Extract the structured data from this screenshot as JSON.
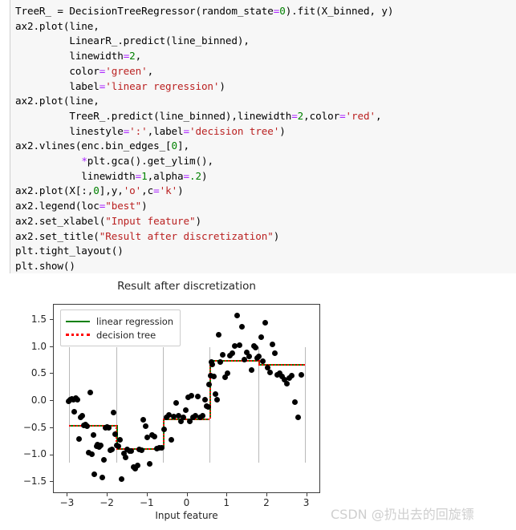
{
  "code_cell": {
    "language": "python",
    "lines": [
      [
        {
          "t": "TreeR_ = DecisionTreeRegressor(random_state",
          "c": "k"
        },
        {
          "t": "=",
          "c": "op"
        },
        {
          "t": "0",
          "c": "n"
        },
        {
          "t": ").fit(X_binned, y)",
          "c": "k"
        }
      ],
      [
        {
          "t": "ax2.plot(line,",
          "c": "k"
        }
      ],
      [
        {
          "t": "         LinearR_.predict(line_binned),",
          "c": "k"
        }
      ],
      [
        {
          "t": "         linewidth",
          "c": "k"
        },
        {
          "t": "=",
          "c": "op"
        },
        {
          "t": "2",
          "c": "n"
        },
        {
          "t": ",",
          "c": "k"
        }
      ],
      [
        {
          "t": "         color",
          "c": "k"
        },
        {
          "t": "=",
          "c": "op"
        },
        {
          "t": "'green'",
          "c": "s"
        },
        {
          "t": ",",
          "c": "k"
        }
      ],
      [
        {
          "t": "         label",
          "c": "k"
        },
        {
          "t": "=",
          "c": "op"
        },
        {
          "t": "'linear regression'",
          "c": "s"
        },
        {
          "t": ")",
          "c": "k"
        }
      ],
      [
        {
          "t": "ax2.plot(line,",
          "c": "k"
        }
      ],
      [
        {
          "t": "         TreeR_.predict(line_binned),linewidth",
          "c": "k"
        },
        {
          "t": "=",
          "c": "op"
        },
        {
          "t": "2",
          "c": "n"
        },
        {
          "t": ",color",
          "c": "k"
        },
        {
          "t": "=",
          "c": "op"
        },
        {
          "t": "'red'",
          "c": "s"
        },
        {
          "t": ",",
          "c": "k"
        }
      ],
      [
        {
          "t": "         linestyle",
          "c": "k"
        },
        {
          "t": "=",
          "c": "op"
        },
        {
          "t": "':'",
          "c": "s"
        },
        {
          "t": ",label",
          "c": "k"
        },
        {
          "t": "=",
          "c": "op"
        },
        {
          "t": "'decision tree'",
          "c": "s"
        },
        {
          "t": ")",
          "c": "k"
        }
      ],
      [
        {
          "t": "ax2.vlines(enc.bin_edges_[",
          "c": "k"
        },
        {
          "t": "0",
          "c": "n"
        },
        {
          "t": "],",
          "c": "k"
        }
      ],
      [
        {
          "t": "           ",
          "c": "k"
        },
        {
          "t": "*",
          "c": "op"
        },
        {
          "t": "plt.gca().get_ylim(),",
          "c": "k"
        }
      ],
      [
        {
          "t": "           linewidth",
          "c": "k"
        },
        {
          "t": "=",
          "c": "op"
        },
        {
          "t": "1",
          "c": "n"
        },
        {
          "t": ",alpha",
          "c": "k"
        },
        {
          "t": "=",
          "c": "op"
        },
        {
          "t": ".2",
          "c": "n"
        },
        {
          "t": ")",
          "c": "k"
        }
      ],
      [
        {
          "t": "ax2.plot(X[:,",
          "c": "k"
        },
        {
          "t": "0",
          "c": "n"
        },
        {
          "t": "],y,",
          "c": "k"
        },
        {
          "t": "'o'",
          "c": "s"
        },
        {
          "t": ",c",
          "c": "k"
        },
        {
          "t": "=",
          "c": "op"
        },
        {
          "t": "'k'",
          "c": "s"
        },
        {
          "t": ")",
          "c": "k"
        }
      ],
      [
        {
          "t": "ax2.legend(loc",
          "c": "k"
        },
        {
          "t": "=",
          "c": "op"
        },
        {
          "t": "\"best\"",
          "c": "s"
        },
        {
          "t": ")",
          "c": "k"
        }
      ],
      [
        {
          "t": "ax2.set_xlabel(",
          "c": "k"
        },
        {
          "t": "\"Input feature\"",
          "c": "s"
        },
        {
          "t": ")",
          "c": "k"
        }
      ],
      [
        {
          "t": "ax2.set_title(",
          "c": "k"
        },
        {
          "t": "\"Result after discretization\"",
          "c": "s"
        },
        {
          "t": ")",
          "c": "k"
        }
      ],
      [
        {
          "t": "plt.tight_layout()",
          "c": "k"
        }
      ],
      [
        {
          "t": "plt.show()",
          "c": "k"
        }
      ]
    ],
    "colors": {
      "background": "#f7f7f7",
      "text": "#000000",
      "string": "#BA2121",
      "number": "#008000",
      "operator": "#AA22FF"
    }
  },
  "watermark": {
    "text": "CSDN @扔出去的回旋镖",
    "color": "#cfcfcf"
  },
  "chart_data": {
    "type": "scatter",
    "title": "Result after discretization",
    "xlabel": "Input feature",
    "ylabel": "",
    "xlim": [
      -3.35,
      3.35
    ],
    "ylim": [
      -1.72,
      1.78
    ],
    "xticks": [
      "-3",
      "-2",
      "-1",
      "0",
      "1",
      "2",
      "3"
    ],
    "xtick_values": [
      -3,
      -2,
      -1,
      0,
      1,
      2,
      3
    ],
    "yticks": [
      "1.5",
      "1.0",
      "0.5",
      "0.0",
      "-0.5",
      "-1.0",
      "-1.5"
    ],
    "ytick_values": [
      1.5,
      1.0,
      0.5,
      0.0,
      -0.5,
      -1.0,
      -1.5
    ],
    "grid": false,
    "legend_position": "upper left",
    "legend": [
      {
        "label": "linear regression",
        "color": "#008000",
        "style": "solid"
      },
      {
        "label": "decision tree",
        "color": "#ff0000",
        "style": "dotted"
      }
    ],
    "bin_edges": [
      -2.96,
      -1.79,
      -0.62,
      0.55,
      1.78,
      2.95
    ],
    "bin_edge_color": "#b9b9b9",
    "step_series": {
      "name": "binned prediction (linear regression == decision tree)",
      "bin_starts": [
        -2.96,
        -1.79,
        -0.62,
        0.55,
        1.78
      ],
      "bin_ends": [
        -1.79,
        -0.62,
        0.55,
        1.78,
        2.95
      ],
      "values": [
        -0.44,
        -0.87,
        -0.33,
        0.76,
        0.68
      ]
    },
    "series": [
      {
        "name": "data",
        "marker": "o",
        "color": "#000000",
        "points": [
          [
            -2.98,
            0.0
          ],
          [
            -2.94,
            0.02
          ],
          [
            -2.9,
            0.04
          ],
          [
            -2.86,
            0.03
          ],
          [
            -2.83,
            -0.2
          ],
          [
            -2.79,
            0.05
          ],
          [
            -2.76,
            0.02
          ],
          [
            -2.71,
            -0.71
          ],
          [
            -2.68,
            -0.3
          ],
          [
            -2.64,
            -0.27
          ],
          [
            -2.6,
            -0.45
          ],
          [
            -2.56,
            -0.44
          ],
          [
            -2.52,
            -0.47
          ],
          [
            -2.47,
            -0.96
          ],
          [
            -2.43,
            0.15
          ],
          [
            -2.4,
            -0.98
          ],
          [
            -2.36,
            -0.63
          ],
          [
            -2.33,
            -1.36
          ],
          [
            -2.28,
            -0.83
          ],
          [
            -2.25,
            -0.8
          ],
          [
            -2.21,
            -0.85
          ],
          [
            -2.17,
            -0.82
          ],
          [
            -2.13,
            -1.41
          ],
          [
            -2.1,
            -1.09
          ],
          [
            -2.06,
            -0.5
          ],
          [
            -2.02,
            -0.48
          ],
          [
            -1.98,
            -0.49
          ],
          [
            -1.94,
            -0.91
          ],
          [
            -1.9,
            -0.89
          ],
          [
            -1.86,
            -0.22
          ],
          [
            -1.82,
            -0.62
          ],
          [
            -1.78,
            -0.82
          ],
          [
            -1.74,
            -0.83
          ],
          [
            -1.7,
            -0.72
          ],
          [
            -1.66,
            -1.45
          ],
          [
            -1.6,
            -0.97
          ],
          [
            -1.55,
            -1.05
          ],
          [
            -1.5,
            -0.9
          ],
          [
            -1.45,
            -0.92
          ],
          [
            -1.4,
            -0.93
          ],
          [
            -1.35,
            -1.22
          ],
          [
            -1.3,
            -1.25
          ],
          [
            -1.25,
            -1.19
          ],
          [
            -1.2,
            -0.89
          ],
          [
            -1.15,
            -0.91
          ],
          [
            -1.1,
            -0.35
          ],
          [
            -1.05,
            -0.47
          ],
          [
            -1.0,
            -0.68
          ],
          [
            -0.95,
            -1.16
          ],
          [
            -0.88,
            -0.63
          ],
          [
            -0.82,
            -0.66
          ],
          [
            -0.76,
            -0.88
          ],
          [
            -0.7,
            -0.87
          ],
          [
            -0.64,
            -0.86
          ],
          [
            -0.58,
            -0.53
          ],
          [
            -0.52,
            -0.3
          ],
          [
            -0.46,
            -0.26
          ],
          [
            -0.4,
            -0.72
          ],
          [
            -0.34,
            -0.29
          ],
          [
            -0.28,
            -0.03
          ],
          [
            -0.22,
            -0.27
          ],
          [
            -0.16,
            -0.37
          ],
          [
            -0.1,
            -0.31
          ],
          [
            -0.05,
            -0.17
          ],
          [
            0.02,
            0.07
          ],
          [
            0.06,
            -0.37
          ],
          [
            0.1,
            0.1
          ],
          [
            0.14,
            -0.3
          ],
          [
            0.2,
            -0.28
          ],
          [
            0.26,
            0.09
          ],
          [
            0.32,
            -0.3
          ],
          [
            0.38,
            -0.27
          ],
          [
            0.44,
            0.03
          ],
          [
            0.48,
            -0.1
          ],
          [
            0.52,
            -0.11
          ],
          [
            0.55,
            0.3
          ],
          [
            0.58,
            0.47
          ],
          [
            0.6,
            0.72
          ],
          [
            0.62,
            0.68
          ],
          [
            0.66,
            0.46
          ],
          [
            0.7,
            0.12
          ],
          [
            0.74,
            0.02
          ],
          [
            0.78,
            1.23
          ],
          [
            0.82,
            0.72
          ],
          [
            0.88,
            0.86
          ],
          [
            0.94,
            0.44
          ],
          [
            1.0,
            0.52
          ],
          [
            1.06,
            0.84
          ],
          [
            1.12,
            0.88
          ],
          [
            1.18,
            1.02
          ],
          [
            1.24,
            1.58
          ],
          [
            1.3,
            1.03
          ],
          [
            1.36,
            1.37
          ],
          [
            1.42,
            0.76
          ],
          [
            1.48,
            0.9
          ],
          [
            1.54,
            0.83
          ],
          [
            1.6,
            0.57
          ],
          [
            1.66,
            1.02
          ],
          [
            1.7,
            0.99
          ],
          [
            1.74,
            0.8
          ],
          [
            1.78,
            0.83
          ],
          [
            1.84,
            1.18
          ],
          [
            1.9,
            0.73
          ],
          [
            1.96,
            1.45
          ],
          [
            2.02,
            0.62
          ],
          [
            2.08,
            0.53
          ],
          [
            2.14,
            1.04
          ],
          [
            2.2,
            0.88
          ],
          [
            2.26,
            0.48
          ],
          [
            2.32,
            0.52
          ],
          [
            2.38,
            0.45
          ],
          [
            2.44,
            0.4
          ],
          [
            2.5,
            0.32
          ],
          [
            2.56,
            0.43
          ],
          [
            2.62,
            0.47
          ],
          [
            2.7,
            -0.02
          ],
          [
            2.78,
            -0.31
          ],
          [
            2.86,
            0.49
          ]
        ]
      }
    ]
  }
}
